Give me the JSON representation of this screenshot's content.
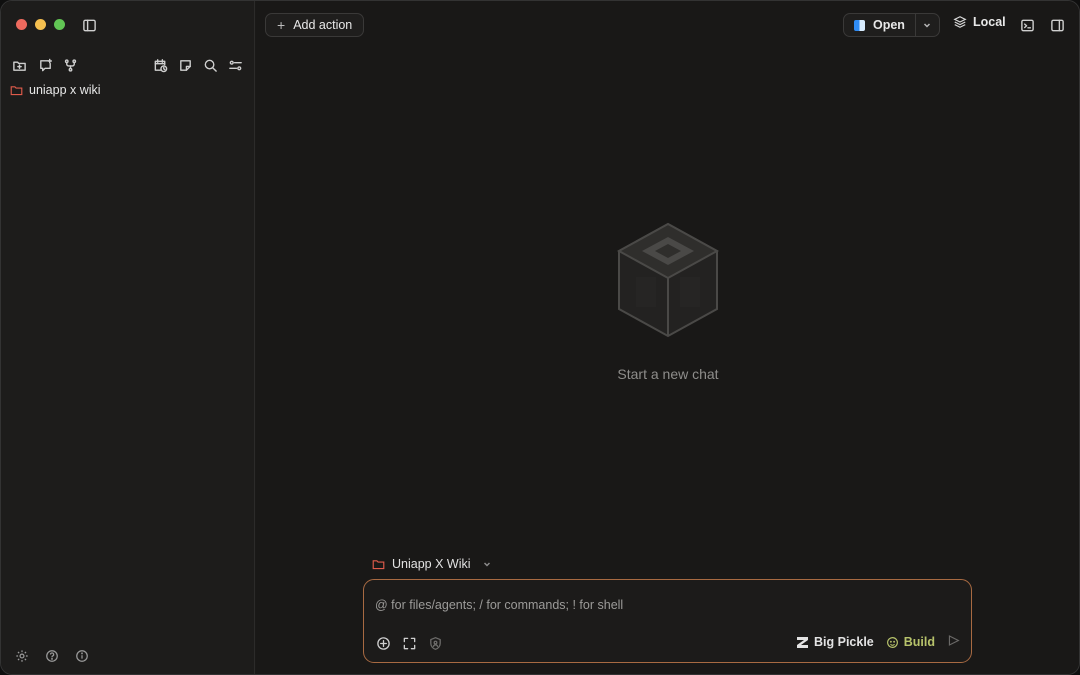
{
  "sidebar": {
    "window_controls": [
      "close",
      "minimize",
      "zoom"
    ],
    "top_icons": [
      "new-folder-icon",
      "new-chat-icon",
      "branch-icon"
    ],
    "right_icons": [
      "calendar-clock-icon",
      "note-icon",
      "search-icon",
      "filter-icon"
    ],
    "projects": [
      {
        "label": "uniapp x wiki",
        "icon": "folder-icon",
        "color": "#e05b4b"
      }
    ],
    "bottom_icons": [
      "settings-icon",
      "help-icon",
      "info-icon"
    ]
  },
  "header": {
    "add_action_label": "Add action",
    "open_label": "Open",
    "local_label": "Local"
  },
  "main": {
    "empty_state_label": "Start a new chat"
  },
  "composer": {
    "project_label": "Uniapp X Wiki",
    "placeholder": "@ for files/agents; / for commands; ! for shell",
    "model_label": "Big Pickle",
    "agent_label": "Build"
  },
  "colors": {
    "accent_border": "#a86a42",
    "folder": "#e05b4b",
    "agent": "#b7c36b"
  }
}
